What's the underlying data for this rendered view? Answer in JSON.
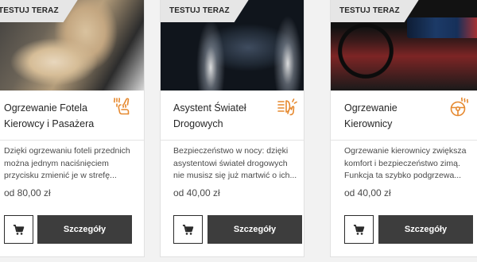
{
  "accent_color": "#e6892f",
  "cards": [
    {
      "badge": "TESTUJ TERAZ",
      "title": "Ogrzewanie Fotela Kierowcy i Pasażera",
      "icon": "heated-seat-icon",
      "description": "Dzięki ogrzewaniu foteli przednich można jednym naciśnięciem przycisku zmienić je w strefę...",
      "price": "od 80,00 zł",
      "cart_icon": "cart-icon",
      "details_label": "Szczegóły"
    },
    {
      "badge": "TESTUJ TERAZ",
      "title": "Asystent Świateł Drogowych",
      "icon": "high-beam-assist-icon",
      "description": "Bezpieczeństwo w nocy: dzięki asystentowi świateł drogowych nie musisz się już martwić o ich...",
      "price": "od 40,00 zł",
      "cart_icon": "cart-icon",
      "details_label": "Szczegóły"
    },
    {
      "badge": "TESTUJ TERAZ",
      "title": "Ogrzewanie Kierownicy",
      "icon": "heated-steering-wheel-icon",
      "description": "Ogrzewanie kierownicy zwiększa komfort i bezpieczeństwo zimą. Funkcja ta szybko podgrzewa...",
      "price": "od 40,00 zł",
      "cart_icon": "cart-icon",
      "details_label": "Szczegóły"
    }
  ]
}
